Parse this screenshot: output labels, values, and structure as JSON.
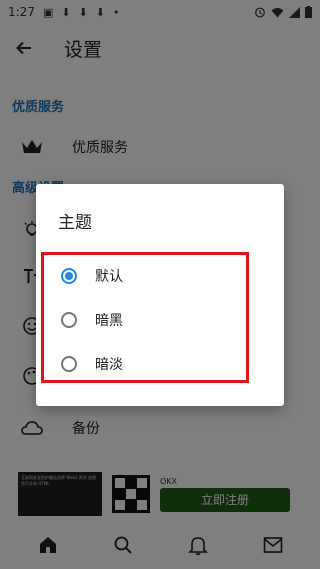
{
  "status_bar": {
    "time": "1:27"
  },
  "app_bar": {
    "title": "设置"
  },
  "sections": {
    "premium_header": "优质服务",
    "premium_item": "优质服务",
    "advanced_header": "高级设置",
    "backup_item": "备份"
  },
  "ad": {
    "thumb_text": "互联网安全防护最佳选择 Web3 资讯 加密货币交易 HTML",
    "name": "OKX",
    "cta": "立即注册",
    "cta_color": "#1f5f17"
  },
  "dialog": {
    "title": "主题",
    "options": [
      {
        "label": "默认",
        "selected": true
      },
      {
        "label": "暗黑",
        "selected": false
      },
      {
        "label": "暗淡",
        "selected": false
      }
    ],
    "highlight_color": "#e3131a",
    "accent_color": "#1e88e5"
  },
  "bottom_nav": {
    "items": [
      "home-icon",
      "search-icon",
      "bell-icon",
      "mail-icon"
    ]
  }
}
